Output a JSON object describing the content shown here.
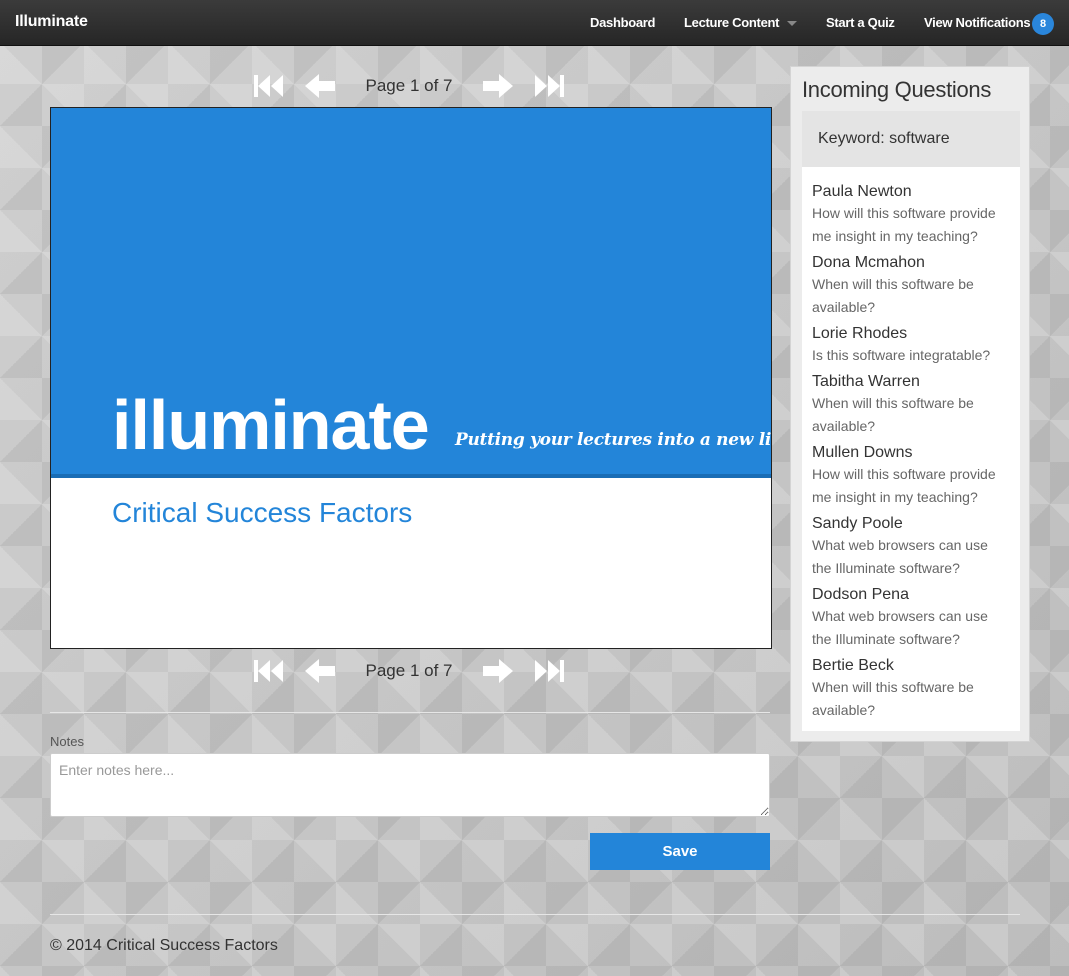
{
  "navbar": {
    "brand": "Illuminate",
    "items": [
      {
        "label": "Dashboard"
      },
      {
        "label": "Lecture Content"
      },
      {
        "label": "Start a Quiz"
      },
      {
        "label": "View Notifications"
      }
    ],
    "notification_count": "8"
  },
  "pager": {
    "label": "Page 1 of 7",
    "icons": [
      "first-page-icon",
      "prev-page-icon",
      "next-page-icon",
      "last-page-icon"
    ]
  },
  "slide": {
    "logo": "illuminate",
    "tagline": "Putting your lectures into a new light.",
    "title": "Critical Success Factors",
    "colors": {
      "primary": "#2385d9",
      "accent": "#1a6db5"
    }
  },
  "notes": {
    "label": "Notes",
    "placeholder": "Enter notes here...",
    "value": ""
  },
  "save_button": "Save",
  "footer": "© 2014 Critical Success Factors",
  "sidebar": {
    "title": "Incoming Questions",
    "keyword": "Keyword: software",
    "questions": [
      {
        "name": "Paula Newton",
        "text": "How will this software provide me insight in my teaching?"
      },
      {
        "name": "Dona Mcmahon",
        "text": "When will this software be available?"
      },
      {
        "name": "Lorie Rhodes",
        "text": "Is this software integratable?"
      },
      {
        "name": "Tabitha Warren",
        "text": "When will this software be available?"
      },
      {
        "name": "Mullen Downs",
        "text": "How will this software provide me insight in my teaching?"
      },
      {
        "name": "Sandy Poole",
        "text": "What web browsers can use the Illuminate software?"
      },
      {
        "name": "Dodson Pena",
        "text": "What web browsers can use the Illuminate software?"
      },
      {
        "name": "Bertie Beck",
        "text": "When will this software be available?"
      }
    ]
  }
}
